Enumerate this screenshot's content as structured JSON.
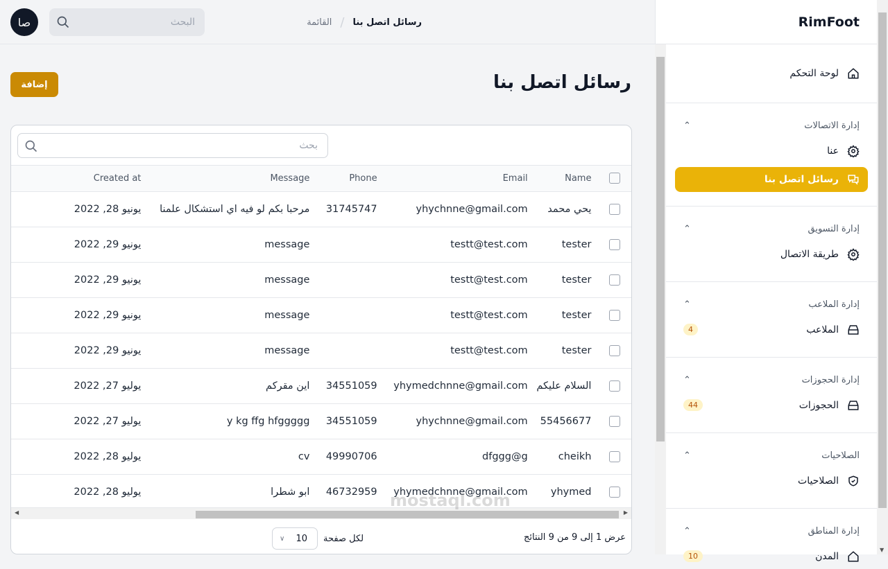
{
  "topbar": {
    "avatar": "صا",
    "search_placeholder": "البحث",
    "breadcrumb": [
      "رسائل اتصل بنا",
      "القائمة"
    ]
  },
  "page": {
    "title": "رسائل اتصل بنا",
    "add_label": "إضافة"
  },
  "table": {
    "search_placeholder": "بحث",
    "columns": [
      "Name",
      "Email",
      "Phone",
      "Message",
      "Created at"
    ],
    "rows": [
      [
        "يحي محمد",
        "yhychnne@gmail.com",
        "31745747",
        "مرحبا بكم لو فيه اي استشكال علمنا",
        "يونيو 28, 2022"
      ],
      [
        "tester",
        "testt@test.com",
        "",
        "message",
        "يونيو 29, 2022"
      ],
      [
        "tester",
        "testt@test.com",
        "",
        "message",
        "يونيو 29, 2022"
      ],
      [
        "tester",
        "testt@test.com",
        "",
        "message",
        "يونيو 29, 2022"
      ],
      [
        "tester",
        "testt@test.com",
        "",
        "message",
        "يونيو 29, 2022"
      ],
      [
        "السلام عليكم",
        "yhymedchnne@gmail.com",
        "34551059",
        "اين مقركم",
        "يوليو 27, 2022"
      ],
      [
        "55456677",
        "yhychnne@gmail.com",
        "34551059",
        "y kg ffg hfggggg",
        "يوليو 27, 2022"
      ],
      [
        "cheikh",
        "dfggg@g",
        "49990706",
        "cv",
        "يوليو 28, 2022"
      ],
      [
        "yhymed",
        "yhymedchnne@gmail.com",
        "46732959",
        "ابو شطرا",
        "يوليو 28, 2022"
      ]
    ],
    "footer": {
      "info": "عرض 1 إلى 9 من 9 النتائج",
      "per_page_value": "10",
      "per_page_label": "لكل صفحة"
    }
  },
  "watermark": "mostaql.com",
  "sidebar": {
    "brand": "RimFoot",
    "dashboard": "لوحة التحكم",
    "groups": [
      {
        "title": "إدارة الاتصالات",
        "items": [
          {
            "label": "عنا",
            "icon": "gear"
          },
          {
            "label": "رسائل اتصل بنا",
            "icon": "chat",
            "active": true
          }
        ]
      },
      {
        "title": "إدارة التسويق",
        "items": [
          {
            "label": "طريقة الاتصال",
            "icon": "gear"
          }
        ]
      },
      {
        "title": "إدارة الملاعب",
        "items": [
          {
            "label": "الملاعب",
            "icon": "archive",
            "badge": "4"
          }
        ]
      },
      {
        "title": "إدارة الحجوزات",
        "items": [
          {
            "label": "الحجوزات",
            "icon": "archive",
            "badge": "44"
          }
        ]
      },
      {
        "title": "الصلاحيات",
        "items": [
          {
            "label": "الصلاحيات",
            "icon": "shield"
          }
        ]
      },
      {
        "title": "إدارة المناطق",
        "items": [
          {
            "label": "المدن",
            "icon": "home",
            "badge": "10"
          }
        ]
      }
    ]
  },
  "colors": {
    "accent": "#eab308",
    "button": "#ca8a04"
  }
}
